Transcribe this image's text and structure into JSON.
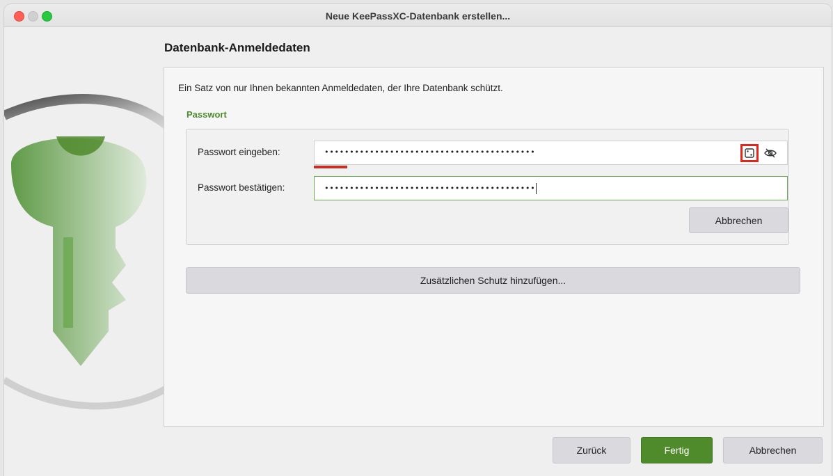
{
  "window": {
    "title": "Neue KeePassXC-Datenbank erstellen..."
  },
  "page": {
    "heading": "Datenbank-Anmeldedaten",
    "description": "Ein Satz von nur Ihnen bekannten Anmeldedaten, der Ihre Datenbank schützt."
  },
  "password_section": {
    "title": "Passwort",
    "enter_label": "Passwort eingeben:",
    "enter_value": "••••••••••••••••••••••••••••••••••••••••••",
    "confirm_label": "Passwort bestätigen:",
    "confirm_value": "••••••••••••••••••••••••••••••••••••••••••",
    "strength_fraction": 0.07,
    "strength_color": "#c62f27",
    "cancel_label": "Abbrechen",
    "generator_icon": "dice-icon",
    "toggle_icon": "eye-slash-icon"
  },
  "additional_protection_label": "Zusätzlichen Schutz hinzufügen...",
  "footer": {
    "back_label": "Zurück",
    "finish_label": "Fertig",
    "cancel_label": "Abbrechen"
  },
  "colors": {
    "accent_green": "#4f8a2b",
    "highlight_red": "#e3261a"
  }
}
